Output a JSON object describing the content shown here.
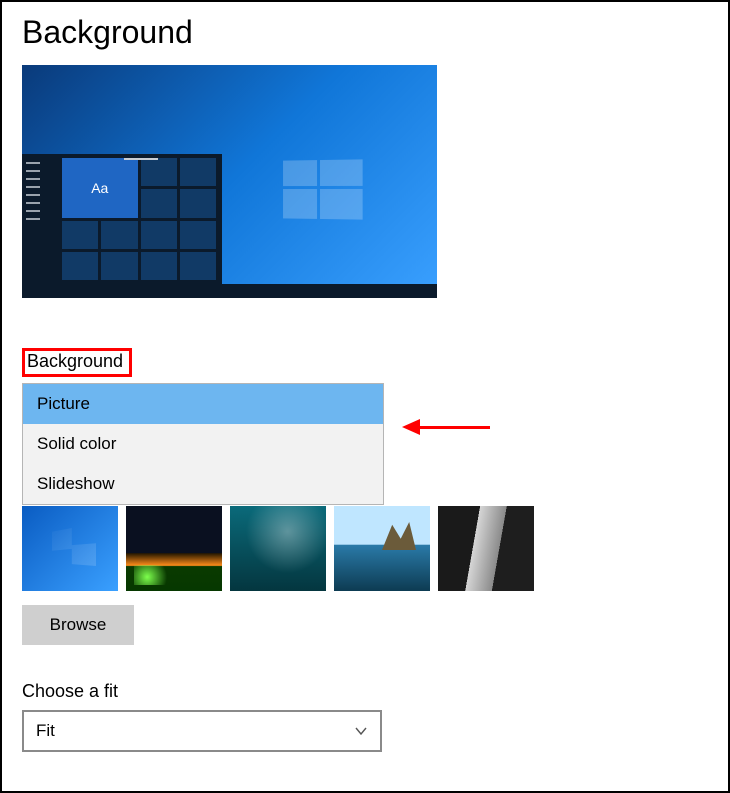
{
  "page": {
    "title": "Background"
  },
  "preview": {
    "sample_text": "Aa"
  },
  "background_section": {
    "label": "Background",
    "options": [
      "Picture",
      "Solid color",
      "Slideshow"
    ],
    "selected": "Picture"
  },
  "thumbnails": {
    "items": [
      {
        "name": "windows-default"
      },
      {
        "name": "night-horizon"
      },
      {
        "name": "underwater"
      },
      {
        "name": "beach-rock"
      },
      {
        "name": "cliff-waterfall"
      }
    ]
  },
  "browse_button": {
    "label": "Browse"
  },
  "fit_section": {
    "label": "Choose a fit",
    "selected": "Fit"
  },
  "annotations": {
    "highlight_target": "background-label",
    "arrow_target": "background-dropdown"
  }
}
